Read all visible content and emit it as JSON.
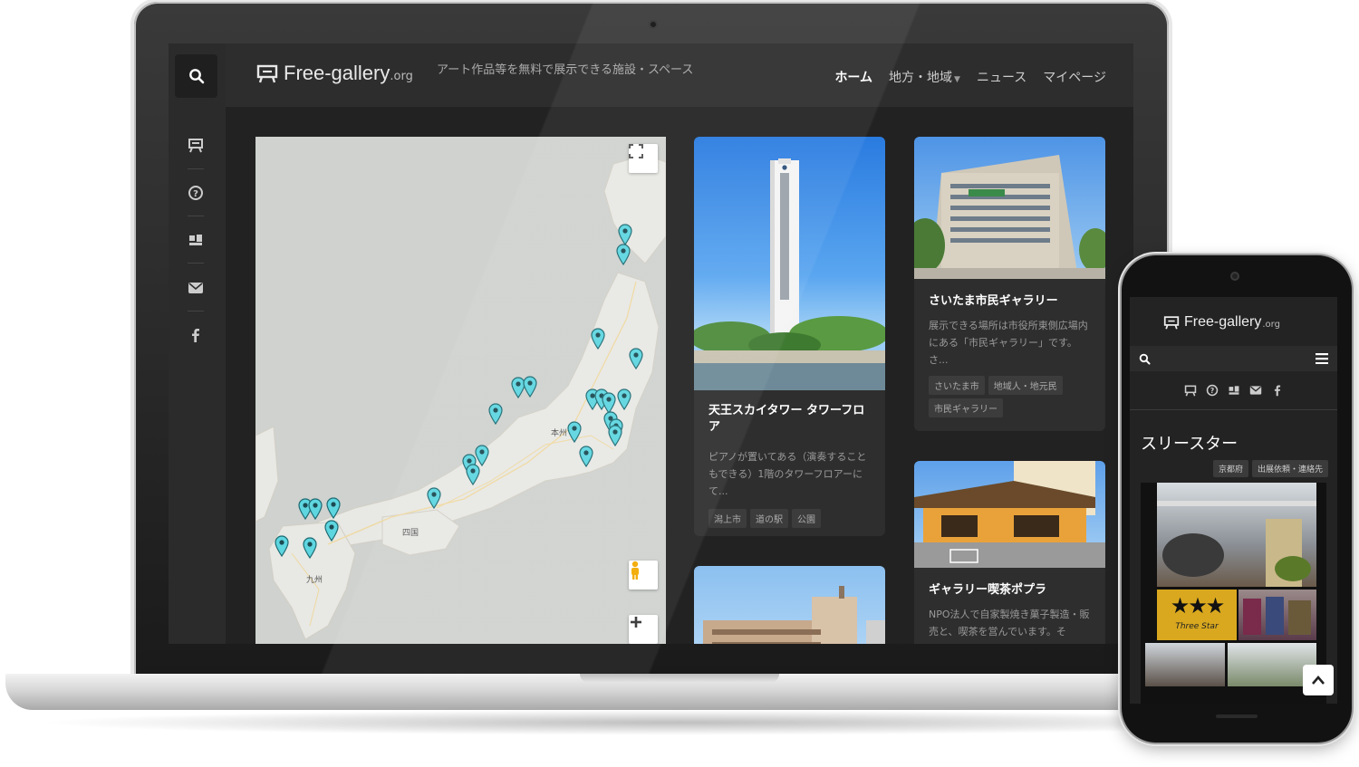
{
  "colors": {
    "marker": "#5ed6e0",
    "map_land": "#e8e8e4",
    "map_sea": "#cfd2cf",
    "header_bg": "#2d2d2d",
    "card_bg": "#2e2e2e"
  },
  "header": {
    "logo_text": "Free-gallery",
    "logo_tld": ".org",
    "tagline": "アート作品等を無料で展示できる施設・スペース",
    "nav": [
      "ホーム",
      "地方・地域",
      "ニュース",
      "マイページ"
    ]
  },
  "rail": {
    "icons": [
      "search-icon",
      "easel-icon",
      "question-icon",
      "gallery-icon",
      "mail-icon",
      "facebook-icon"
    ]
  },
  "map": {
    "labels": [
      "本州",
      "四国",
      "九州"
    ],
    "controls": [
      "fullscreen-icon",
      "pegman-icon",
      "zoom-in-icon"
    ],
    "marker_count": 28
  },
  "cards": [
    {
      "title": "天王スカイタワー タワーフロア",
      "text": "ピアノが置いてある（演奏することもできる）1階のタワーフロアーにて...",
      "tags": [
        "潟上市",
        "道の駅",
        "公園"
      ]
    },
    {
      "title": "さいたま市民ギャラリー",
      "text": "展示できる場所は市役所東側広場内にある「市民ギャラリー」です。 さ...",
      "tags": [
        "さいたま市",
        "地域人・地元民",
        "市民ギャラリー"
      ]
    },
    {
      "title": "ギャラリー喫茶ポプラ",
      "text": "NPO法人で自家製焼き菓子製造・販売と、喫茶を営んでいます。そ"
    }
  ],
  "phone": {
    "logo_text": "Free-gallery",
    "logo_tld": ".org",
    "title": "スリースター",
    "tags": [
      "京都府",
      "出展依頼・連絡先"
    ],
    "sign_text": "Three Star"
  }
}
